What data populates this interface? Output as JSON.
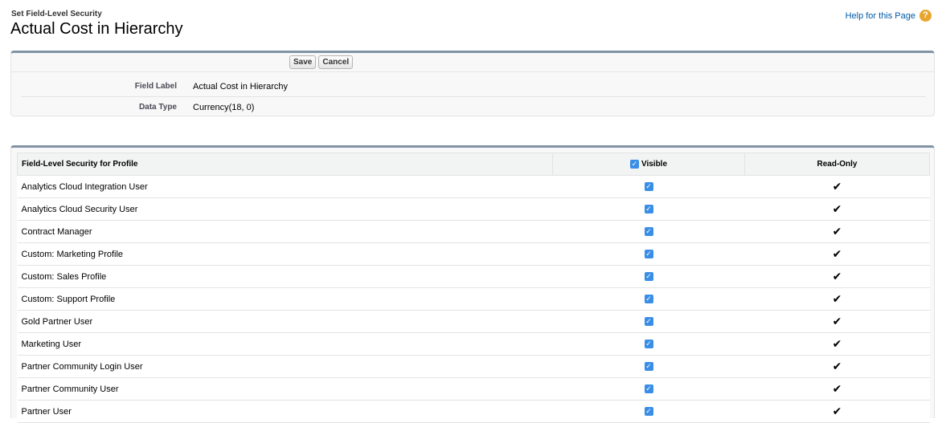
{
  "header": {
    "subtitle": "Set Field-Level Security",
    "title": "Actual Cost in Hierarchy",
    "help_link": "Help for this Page",
    "help_icon": "?"
  },
  "toolbar": {
    "save_label": "Save",
    "cancel_label": "Cancel"
  },
  "field_info": {
    "field_label_label": "Field Label",
    "field_label_value": "Actual Cost in Hierarchy",
    "data_type_label": "Data Type",
    "data_type_value": "Currency(18, 0)"
  },
  "table": {
    "col_profile": "Field-Level Security for Profile",
    "col_visible": "Visible",
    "col_readonly": "Read-Only",
    "check_mark": "✓",
    "tick_mark": "✔",
    "rows": [
      {
        "profile": "Analytics Cloud Integration User",
        "visible": true,
        "read_only": true
      },
      {
        "profile": "Analytics Cloud Security User",
        "visible": true,
        "read_only": true
      },
      {
        "profile": "Contract Manager",
        "visible": true,
        "read_only": true
      },
      {
        "profile": "Custom: Marketing Profile",
        "visible": true,
        "read_only": true
      },
      {
        "profile": "Custom: Sales Profile",
        "visible": true,
        "read_only": true
      },
      {
        "profile": "Custom: Support Profile",
        "visible": true,
        "read_only": true
      },
      {
        "profile": "Gold Partner User",
        "visible": true,
        "read_only": true
      },
      {
        "profile": "Marketing User",
        "visible": true,
        "read_only": true
      },
      {
        "profile": "Partner Community Login User",
        "visible": true,
        "read_only": true
      },
      {
        "profile": "Partner Community User",
        "visible": true,
        "read_only": true
      },
      {
        "profile": "Partner User",
        "visible": true,
        "read_only": true
      }
    ]
  },
  "colors": {
    "accent": "#015ba7",
    "checkbox": "#3a8ee6",
    "panel_border": "#8094a4",
    "help_icon": "#e8a630"
  }
}
